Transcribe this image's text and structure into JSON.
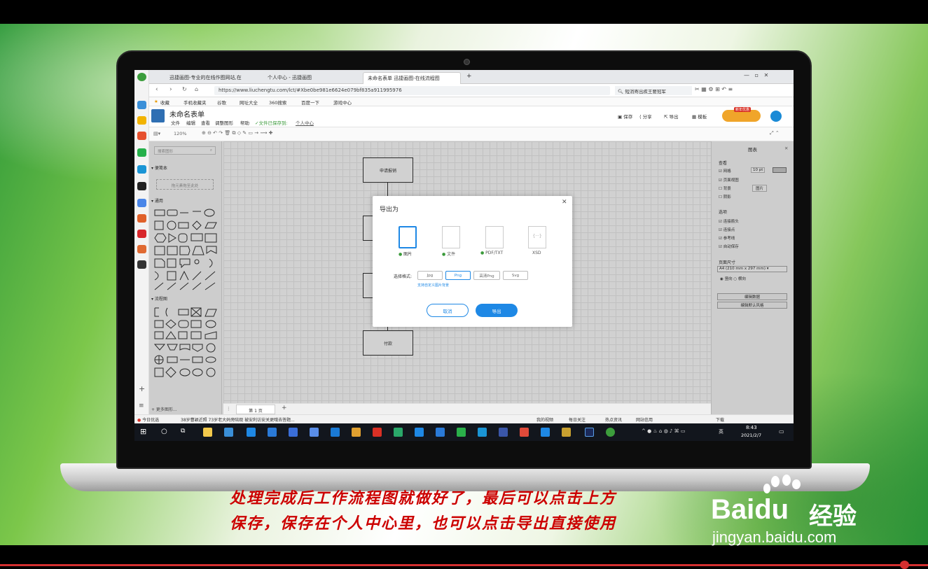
{
  "browser": {
    "tabs": [
      "迅捷画图-专业的在线作图网站,在",
      "个人中心 - 迅捷画图",
      "未命名表单 迅捷画图-在线流程图"
    ],
    "url": "https://www.liuchengtu.com/lct/#Xbe0be981e6624e079bf835a911995976",
    "search": "短消寄出疾王要冠军",
    "bookmarks": [
      "收藏",
      "手机收藏夹",
      "谷歌",
      "网址大全",
      "360搜索",
      "百度一下",
      "游戏中心"
    ]
  },
  "app": {
    "title": "未命名表单",
    "menus": [
      "文件",
      "编辑",
      "查看",
      "调整图形",
      "帮助"
    ],
    "save_status": "文件已保存到:",
    "save_location": "个人中心",
    "actions": [
      "保存",
      "分享",
      "导出",
      "模板"
    ],
    "vip_badge": "新年优惠",
    "zoom": "120%"
  },
  "shapes_panel": {
    "search_placeholder": "搜索图形",
    "scratchpad": "便笺本",
    "drop_hint": "拖元素拖至此处",
    "general": "通用",
    "flowchart": "流程图",
    "arrows": "箭头",
    "more_shapes": "+ 更多图形..."
  },
  "canvas": {
    "nodes": [
      "申请报销",
      "付款"
    ],
    "page_tab": "第 1 页"
  },
  "right_panel": {
    "title": "图表",
    "view_heading": "查看",
    "grid": "网格",
    "grid_size": "10 pt",
    "page_view": "页面视图",
    "background": "背景",
    "shadow": "阴影",
    "image_button": "图片",
    "options_heading": "选项",
    "opt1": "连接箭头",
    "opt2": "连接点",
    "opt3": "参考线",
    "opt4": "自动保存",
    "paper_heading": "页面尺寸",
    "paper_size": "A4 (210 mm x 297 mm)",
    "portrait": "竖向",
    "landscape": "横向",
    "edit_data": "编辑数据",
    "edit_style": "编辑默认风格"
  },
  "dialog": {
    "title": "导出为",
    "options": [
      "图片",
      "文件",
      "PDF/TXT",
      "XSD"
    ],
    "format_label": "选择格式:",
    "formats": [
      "Jpg",
      "Png",
      "高清Png",
      "Svg"
    ],
    "custom_bg_link": "支持自定义图片背景",
    "cancel": "取消",
    "export": "导出"
  },
  "news_bar": {
    "left": "今日优选",
    "headline": "38岁曹颖近照 73岁老大妈旁陪观 被安利访安关更哦去答题...",
    "items": [
      "我的视频",
      "每日关注",
      "热点资讯",
      "网站信用",
      "下载"
    ]
  },
  "taskbar": {
    "time": "8:43",
    "date": "2021/2/7",
    "ime": "英"
  },
  "caption": {
    "line1": "处理完成后工作流程图就做好了，最后可以点击上方",
    "line2": "保存，保存在个人中心里，也可以点击导出直接使用"
  },
  "watermark": {
    "brand": "Bai",
    "brand2": "du",
    "product": "经验",
    "site": "jingyan.baidu.com"
  },
  "colors": {
    "accent": "#1e88e5",
    "caption": "#cc0000",
    "taskbar": "#12161d"
  }
}
